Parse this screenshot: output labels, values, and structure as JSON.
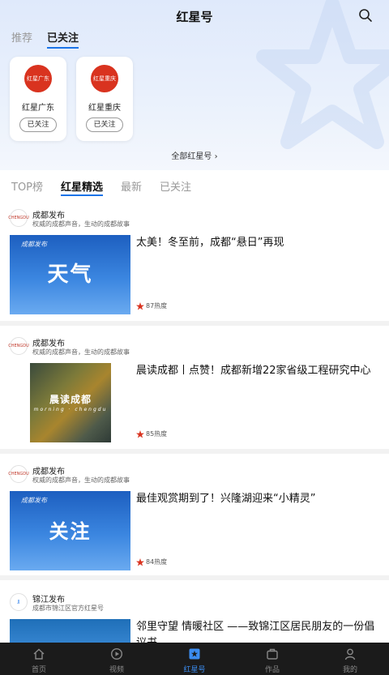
{
  "header": {
    "title": "红星号"
  },
  "top_tabs": [
    {
      "label": "推荐"
    },
    {
      "label": "已关注"
    }
  ],
  "followed_accounts": [
    {
      "name": "红星广东",
      "logo_text": "红星广东",
      "follow_label": "已关注"
    },
    {
      "name": "红星重庆",
      "logo_text": "红星重庆",
      "follow_label": "已关注"
    }
  ],
  "all_link": "全部红星号",
  "sub_tabs": [
    {
      "label": "TOP榜"
    },
    {
      "label": "红星精选"
    },
    {
      "label": "最新"
    },
    {
      "label": "已关注"
    }
  ],
  "feed": [
    {
      "source": "成都发布",
      "desc": "权威的成都声音，生动的成都故事",
      "thumb_text": "天气",
      "thumb_mini": "成都发布",
      "headline": "太美！冬至前，成都“悬日”再现",
      "heat": "87热度"
    },
    {
      "source": "成都发布",
      "desc": "权威的成都声音，生动的成都故事",
      "thumb_text": "晨读成都",
      "thumb_mini": "morning · chengdu",
      "headline": "晨读成都丨点赞！成都新增22家省级工程研究中心",
      "heat": "85热度"
    },
    {
      "source": "成都发布",
      "desc": "权威的成都声音，生动的成都故事",
      "thumb_text": "关注",
      "thumb_mini": "成都发布",
      "headline": "最佳观赏期到了！兴隆湖迎来“小精灵”",
      "heat": "84热度"
    },
    {
      "source": "锦江发布",
      "desc": "成都市锦江区官方红星号",
      "thumb_text": "",
      "thumb_mini": "",
      "headline": "邻里守望 情暖社区 ——致锦江区居民朋友的一份倡议书",
      "heat": ""
    }
  ],
  "bottom_nav": [
    {
      "label": "首页",
      "icon": "home-icon"
    },
    {
      "label": "视频",
      "icon": "video-icon"
    },
    {
      "label": "红星号",
      "icon": "redstar-icon"
    },
    {
      "label": "作品",
      "icon": "works-icon"
    },
    {
      "label": "我的",
      "icon": "profile-icon"
    }
  ],
  "colors": {
    "accent": "#1a73e8",
    "brand_red": "#d9331f",
    "nav_bg": "#1b1b1b"
  }
}
